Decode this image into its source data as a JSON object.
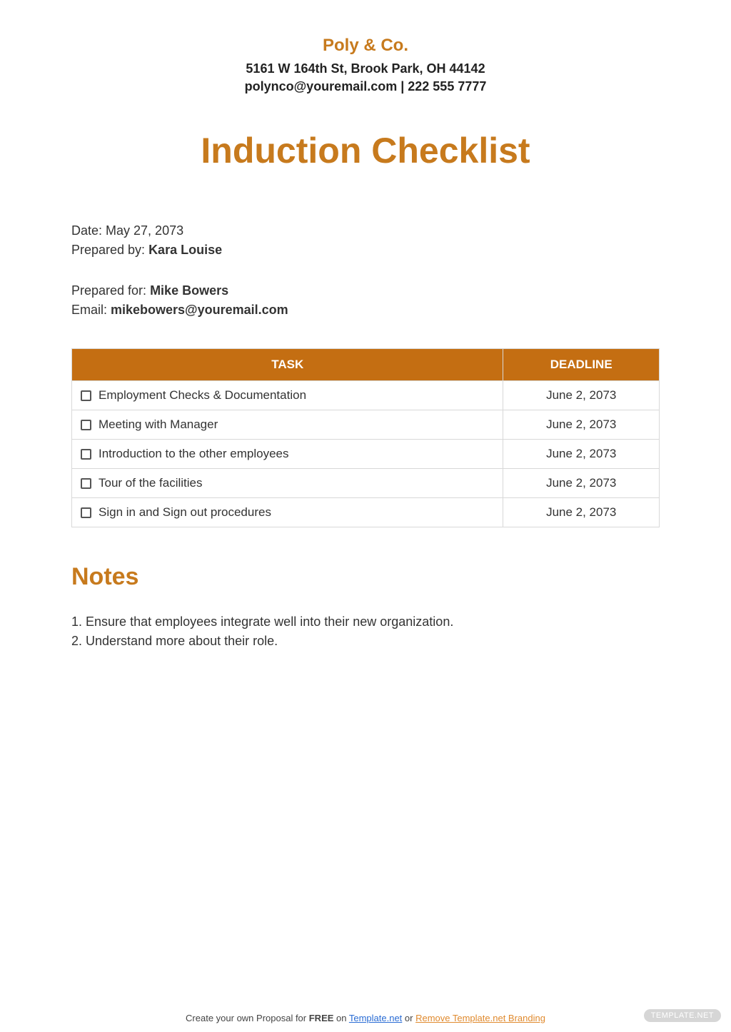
{
  "company": {
    "name": "Poly & Co.",
    "address": "5161 W 164th St, Brook Park, OH 44142",
    "contact": "polynco@youremail.com | 222 555 7777"
  },
  "document": {
    "title": "Induction Checklist"
  },
  "meta": {
    "date_label": "Date: ",
    "date_value": "May 27, 2073",
    "prepared_by_label": "Prepared by: ",
    "prepared_by_value": "Kara Louise",
    "prepared_for_label": "Prepared for: ",
    "prepared_for_value": "Mike Bowers",
    "email_label": "Email: ",
    "email_value": "mikebowers@youremail.com"
  },
  "table": {
    "headers": {
      "task": "TASK",
      "deadline": "DEADLINE"
    },
    "rows": [
      {
        "task": "Employment Checks & Documentation",
        "deadline": "June 2, 2073"
      },
      {
        "task": "Meeting with Manager",
        "deadline": "June 2, 2073"
      },
      {
        "task": "Introduction to the other employees",
        "deadline": "June 2, 2073"
      },
      {
        "task": "Tour of the facilities",
        "deadline": "June 2, 2073"
      },
      {
        "task": "Sign in and Sign out procedures",
        "deadline": "June 2, 2073"
      }
    ]
  },
  "notes": {
    "title": "Notes",
    "items": [
      "Ensure that employees integrate well into their new organization.",
      "Understand more about their role."
    ]
  },
  "footer": {
    "prefix": "Create your own Proposal for ",
    "free": "FREE",
    "on": " on     ",
    "link1": "Template.net",
    "or": "   or  ",
    "link2": "Remove Template.net Branding"
  },
  "watermark": "TEMPLATE.NET"
}
